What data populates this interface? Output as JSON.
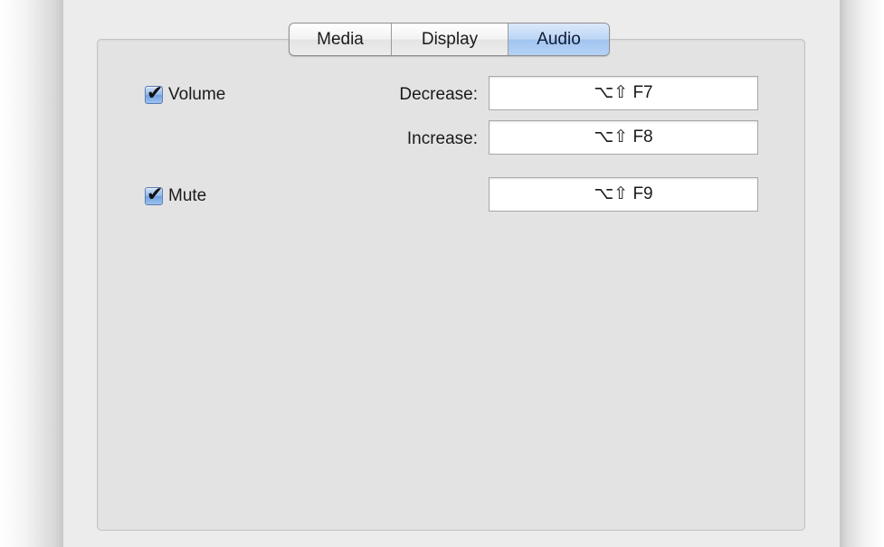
{
  "tabs": [
    {
      "label": "Media",
      "selected": false
    },
    {
      "label": "Display",
      "selected": false
    },
    {
      "label": "Audio",
      "selected": true
    }
  ],
  "volume": {
    "label": "Volume",
    "checked": true,
    "decrease": {
      "label": "Decrease:",
      "shortcut": "⌥⇧ F7"
    },
    "increase": {
      "label": "Increase:",
      "shortcut": "⌥⇧ F8"
    }
  },
  "mute": {
    "label": "Mute",
    "checked": true,
    "shortcut": "⌥⇧ F9"
  },
  "colors": {
    "selected_tab": "#b5d2f6",
    "panel_background": "#e3e3e3"
  },
  "icons": {
    "checkmark": "✔"
  }
}
